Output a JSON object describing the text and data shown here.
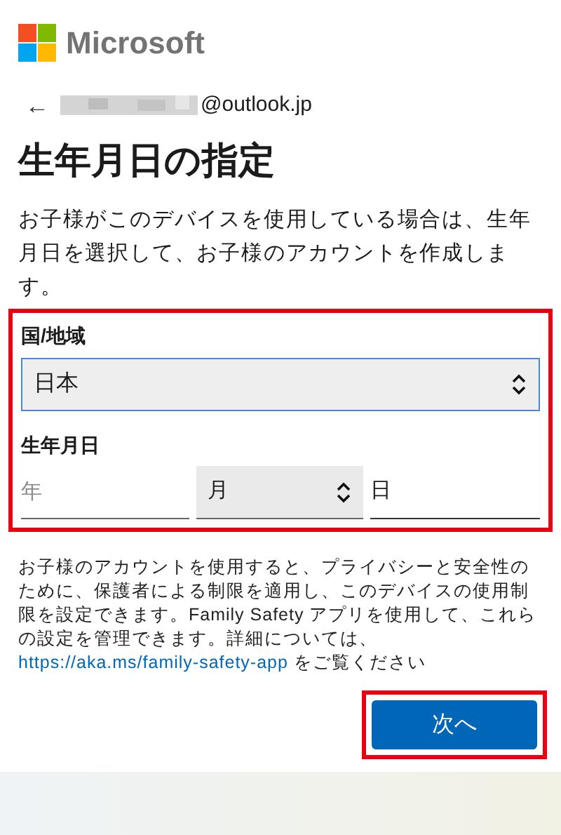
{
  "brand": {
    "name": "Microsoft"
  },
  "account": {
    "back": "←",
    "email_domain": "@outlook.jp",
    "email_redacted": true
  },
  "title": "生年月日の指定",
  "description": "お子様がこのデバイスを使用している場合は、生年月日を選択して、お子様のアカウントを作成します。",
  "form": {
    "highlighted": true,
    "country": {
      "label": "国/地域",
      "value": "日本",
      "focused": true
    },
    "birthdate": {
      "label": "生年月日",
      "year": {
        "placeholder": "年"
      },
      "month": {
        "value": "月"
      },
      "day": {
        "value": "日"
      }
    }
  },
  "notice": {
    "text": "お子様のアカウントを使用すると、プライバシーと安全性のために、保護者による制限を適用し、このデバイスの使用制限を設定できます。Family Safety アプリを使用して、これらの設定を管理できます。詳細については、",
    "link": "https://aka.ms/family-safety-app",
    "after": " をご覧ください"
  },
  "next_button": {
    "label": "次へ",
    "highlighted": true
  }
}
